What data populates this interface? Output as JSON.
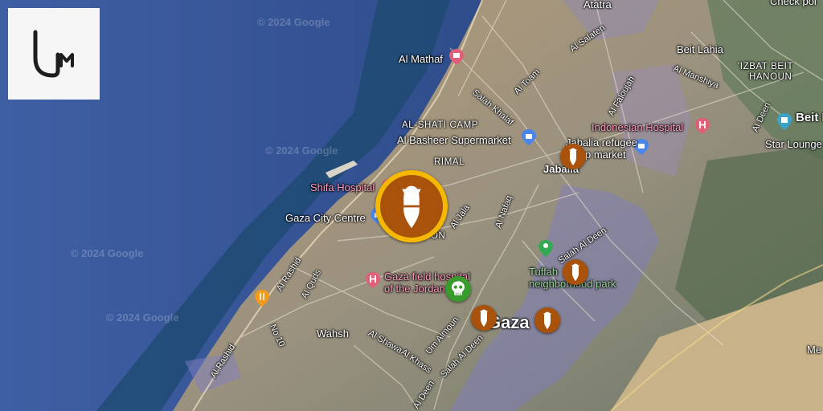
{
  "watermark": "© 2024 Google",
  "places": {
    "al_mathaf": "Al Mathaf",
    "atatra": "Atatra",
    "beit_lahia": "Beit Lahia",
    "check_point": "Check poi",
    "izbat_beit_hanoun_line1": "'IZBAT BEIT",
    "izbat_beit_hanoun_line2": "HANOUN",
    "beit_h": "Beit H",
    "star_lounge": "Star Lounge",
    "al_shati_camp": "AL-SHATI CAMP",
    "al_basheer": "Al Basheer Supermarket",
    "indonesian_hospital": "Indonesian Hospital",
    "jabalia_refugee_line1": "Jabalia refugee",
    "jabalia_refugee_line2": "p market",
    "jabalia": "Jabalia",
    "rimal": "RIMAL",
    "shifa_hospital": "Shifa Hospital",
    "gaza_city_centre": "Gaza City Centre",
    "tuffah_line1": "Tuffah",
    "tuffah_line2": "neighborhood park",
    "field_hospital_line1": "Gaza field hospital",
    "field_hospital_line2": "of the Jordan",
    "wahsh": "Wahsh",
    "gaza": "Gaza",
    "on": "ON",
    "me": "Me"
  },
  "roads": {
    "al_saladin": "Al Salaten",
    "al_toam": "Al Toam",
    "salah_khalaf": "Salah Khalaf",
    "al_faloujah": "Al Faloujah",
    "al_manshiya": "Al Manshiya",
    "al_deen": "Al Deen",
    "salah_al_deen_e": "Salah Al Deen",
    "al_jala": "Al Jala",
    "al_nafaq": "Al Nafaq",
    "al_rashid": "Al Rashid",
    "al_quds": "Al Quds",
    "no10": "No 10",
    "al_rashid_2": "Al Rashid",
    "al_shawa": "Al Shawa",
    "al_khass": "Al Khass",
    "um_almoun": "Um Almoun",
    "salah_al_deen_s": "Salah Al Deen",
    "al_deen_2": "Al Deen"
  },
  "markers": {
    "featured": "bomb-icon",
    "items": [
      "bomb-icon",
      "bomb-icon",
      "bomb-icon",
      "bomb-icon",
      "skull-icon"
    ]
  },
  "colors": {
    "sea": "#3d5ea0",
    "land": "#a69a7e",
    "strike_marker": "#a8520c",
    "featured_ring": "#f5b800",
    "casualty_marker": "#3a9b2d",
    "hospital_pin": "#e0607a",
    "shop_pin": "#4a86e8",
    "park_pin": "#34a853",
    "food_pin": "#f29b1a",
    "highlight_zone": "#7c7cc8"
  }
}
